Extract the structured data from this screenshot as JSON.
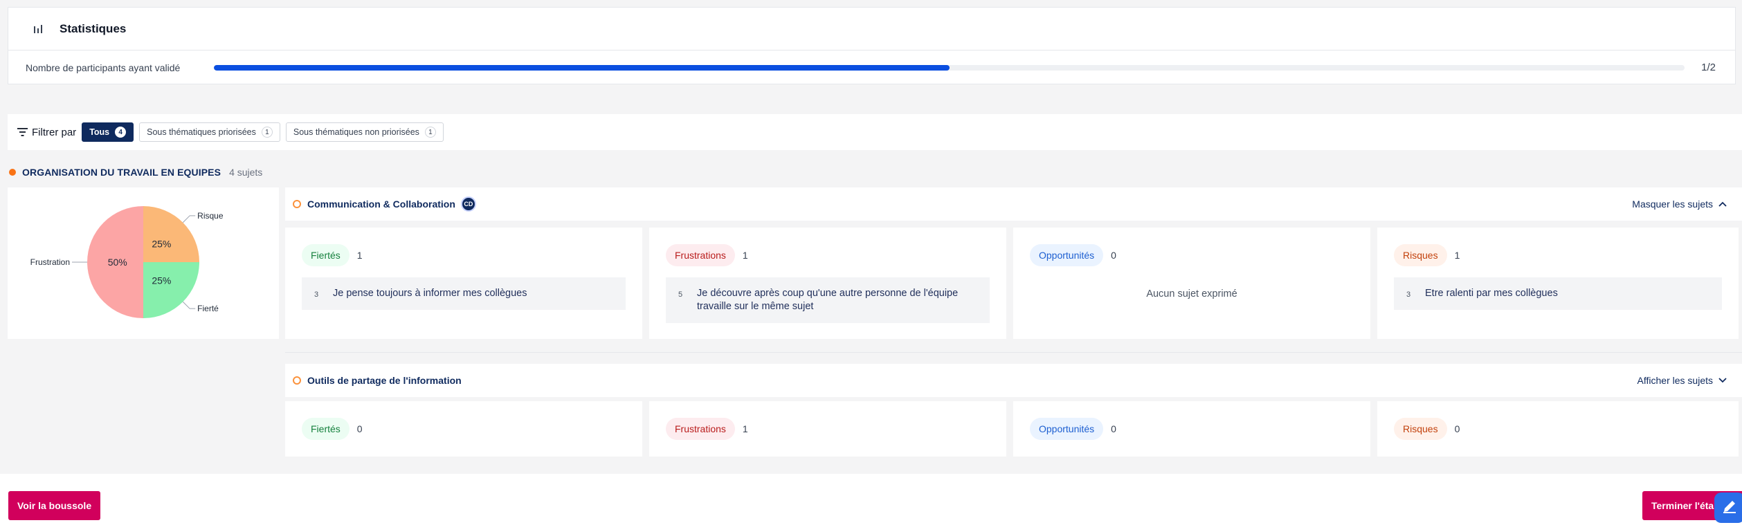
{
  "stats": {
    "title": "Statistiques",
    "participants_label": "Nombre de participants ayant validé",
    "progress_fraction": 0.5,
    "count": "1/2"
  },
  "filter": {
    "label": "Filtrer par",
    "chips": [
      {
        "label": "Tous",
        "count": "4",
        "active": true
      },
      {
        "label": "Sous thématiques priorisées",
        "count": "1",
        "active": false
      },
      {
        "label": "Sous thématiques non priorisées",
        "count": "1",
        "active": false
      }
    ]
  },
  "section": {
    "title": "ORGANISATION DU TRAVAIL EN EQUIPES",
    "count": "4 sujets"
  },
  "chart_data": {
    "type": "pie",
    "slices": [
      {
        "label": "Risque",
        "value": 25,
        "text": "25%",
        "color": "#fbb877"
      },
      {
        "label": "Fierté",
        "value": 25,
        "text": "25%",
        "color": "#86efac"
      },
      {
        "label": "Frustration",
        "value": 50,
        "text": "50%",
        "color": "#fca5a5"
      }
    ]
  },
  "themes": [
    {
      "title": "Communication & Collaboration",
      "avatar": "CD",
      "toggle_label": "Masquer les sujets",
      "toggle_icon": "chevron-up-icon",
      "cards": [
        {
          "tag": "Fiertés",
          "count": "1",
          "kind": "fierte",
          "topic_num": "3",
          "topic": "Je pense toujours à informer mes collègues"
        },
        {
          "tag": "Frustrations",
          "count": "1",
          "kind": "frus",
          "topic_num": "5",
          "topic": "Je découvre après coup qu'une autre personne de l'équipe travaille sur le même sujet"
        },
        {
          "tag": "Opportunités",
          "count": "0",
          "kind": "oppo",
          "empty": "Aucun sujet exprimé"
        },
        {
          "tag": "Risques",
          "count": "1",
          "kind": "risq",
          "topic_num": "3",
          "topic": "Etre ralenti par mes collègues"
        }
      ]
    },
    {
      "title": "Outils de partage de l'information",
      "toggle_label": "Afficher les sujets",
      "toggle_icon": "chevron-down-icon",
      "cards": [
        {
          "tag": "Fiertés",
          "count": "0",
          "kind": "fierte"
        },
        {
          "tag": "Frustrations",
          "count": "1",
          "kind": "frus"
        },
        {
          "tag": "Opportunités",
          "count": "0",
          "kind": "oppo"
        },
        {
          "tag": "Risques",
          "count": "0",
          "kind": "risq"
        }
      ]
    }
  ],
  "footer": {
    "left_button": "Voir la boussole",
    "right_button": "Terminer l'étape"
  },
  "colors": {
    "primary": "#0f2a5e",
    "accent": "#d1005c",
    "progress": "#0b4fe0",
    "fab": "#2a6ee8"
  }
}
